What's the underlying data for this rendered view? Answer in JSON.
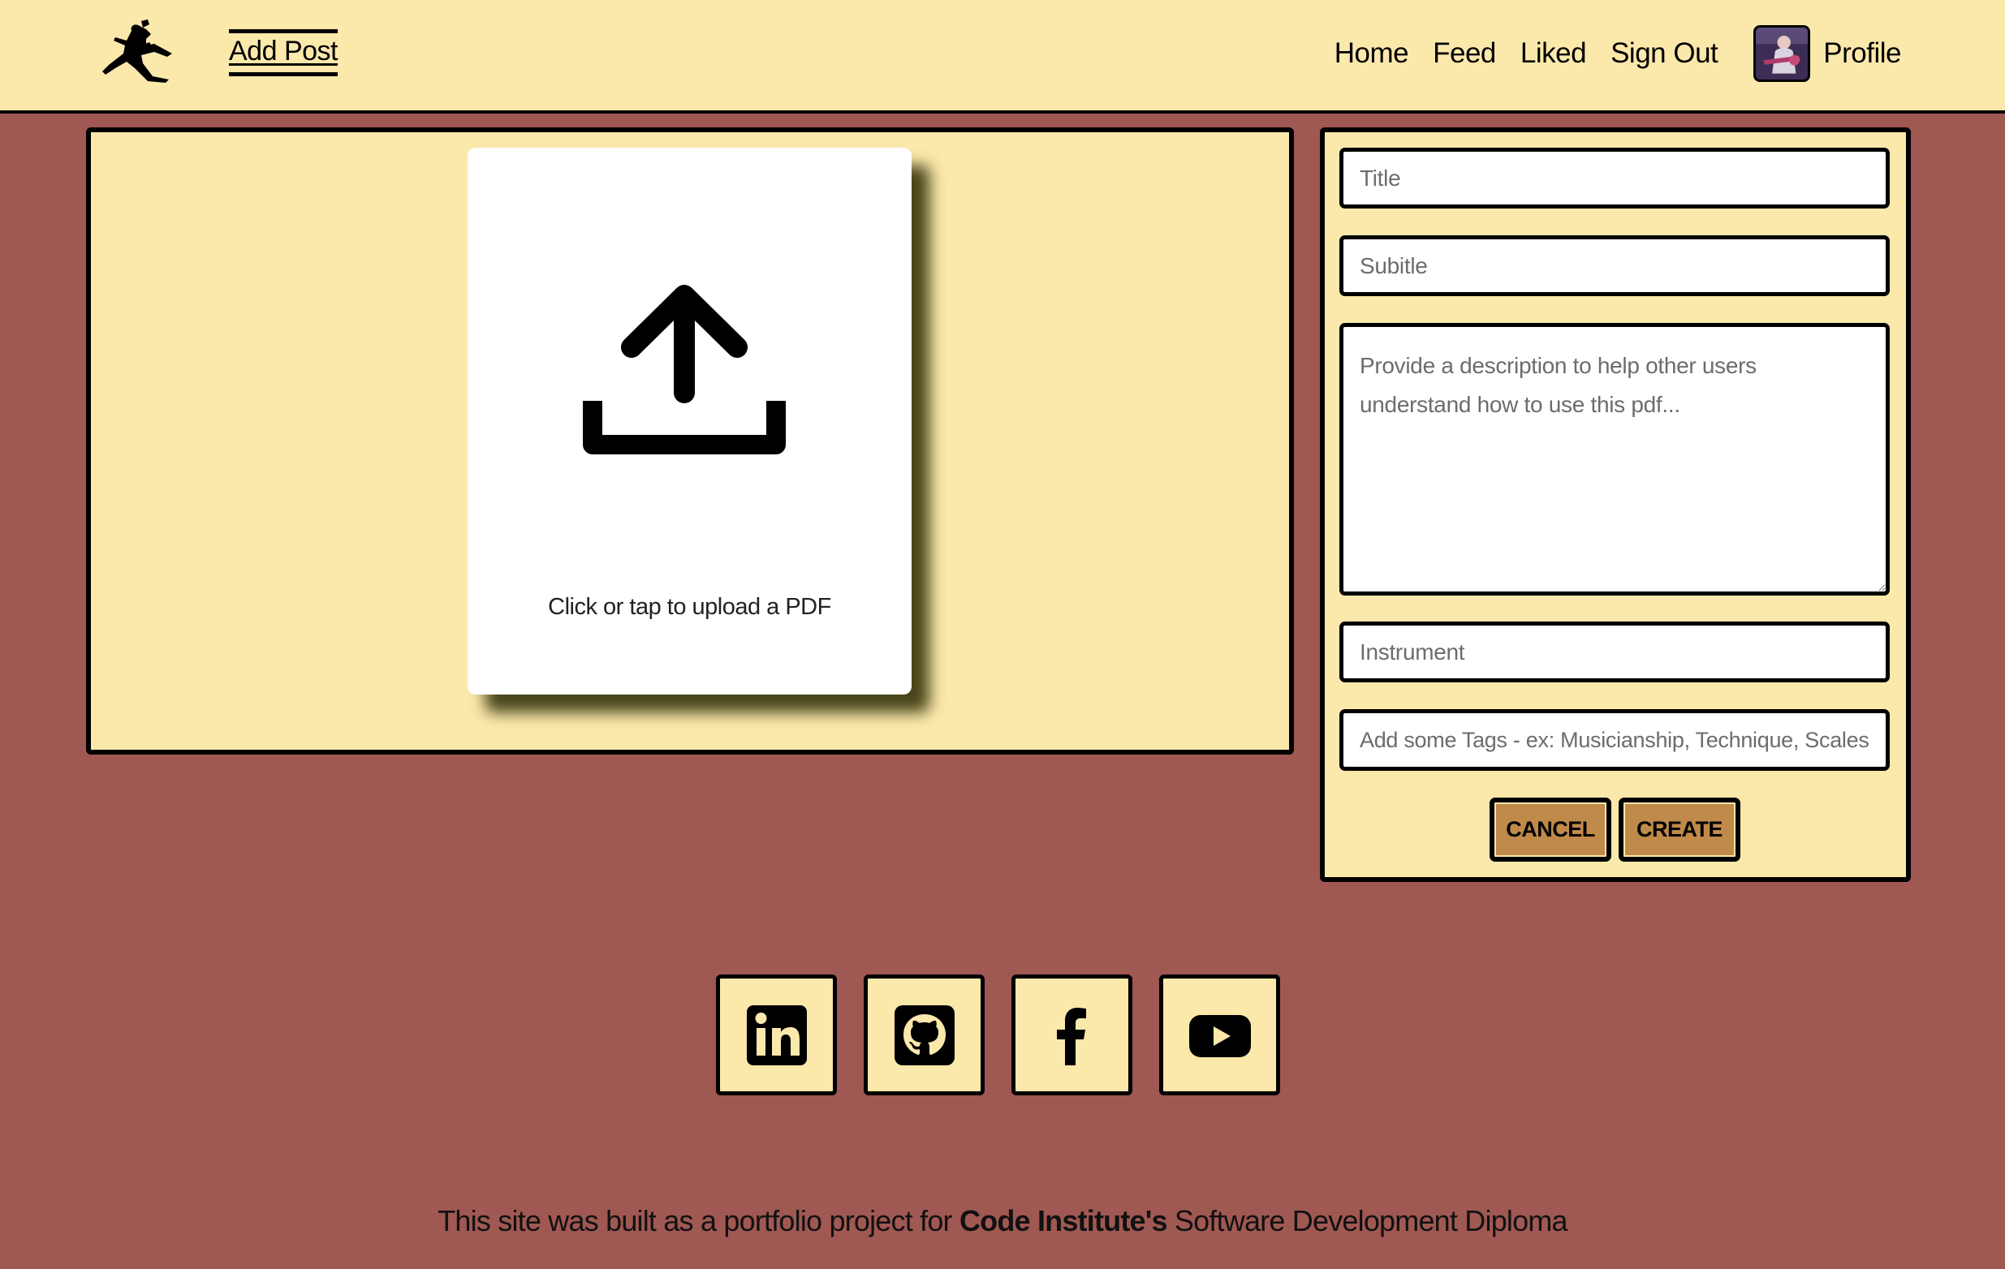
{
  "navbar": {
    "brand_icon": "guitarist-jump-logo",
    "add_post": "Add Post",
    "links": [
      "Home",
      "Feed",
      "Liked",
      "Sign Out"
    ],
    "profile": "Profile",
    "avatar_icon": "profile-avatar"
  },
  "upload": {
    "icon": "upload-icon",
    "label": "Click or tap to upload a PDF"
  },
  "form": {
    "title_placeholder": "Title",
    "subtitle_placeholder": "Subitle",
    "description_placeholder": "Provide a description to help other users understand how to use this pdf...",
    "instrument_placeholder": "Instrument",
    "tags_placeholder": "Add some Tags - ex: Musicianship, Technique, Scales,...",
    "cancel_label": "CANCEL",
    "create_label": "CREATE"
  },
  "social": [
    {
      "icon": "linkedin-icon"
    },
    {
      "icon": "github-icon"
    },
    {
      "icon": "facebook-icon"
    },
    {
      "icon": "youtube-icon"
    }
  ],
  "footer": {
    "prefix": "This site was built as a portfolio project for ",
    "bold": "Code Institute's",
    "suffix": " Software Development Diploma"
  },
  "colors": {
    "background": "#a05852",
    "panel": "#fbe8ab",
    "button": "#c08a4a",
    "border": "#000000"
  }
}
